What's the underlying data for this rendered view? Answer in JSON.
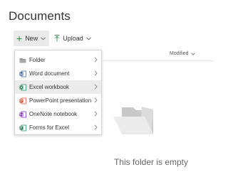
{
  "page": {
    "title": "Documents"
  },
  "commandbar": {
    "new_label": "New",
    "upload_label": "Upload"
  },
  "columns": {
    "modified": "Modified"
  },
  "menu": {
    "items": [
      {
        "label": "Folder",
        "icon": "folder-icon"
      },
      {
        "label": "Word document",
        "icon": "word-icon"
      },
      {
        "label": "Excel workbook",
        "icon": "excel-icon"
      },
      {
        "label": "PowerPoint presentation",
        "icon": "powerpoint-icon"
      },
      {
        "label": "OneNote notebook",
        "icon": "onenote-icon"
      },
      {
        "label": "Forms for Excel",
        "icon": "forms-icon"
      }
    ],
    "hovered_index": 2
  },
  "empty": {
    "message": "This folder is empty"
  },
  "colors": {
    "accent_plus": "#2e8a3e",
    "word": "#2b579a",
    "excel": "#217346",
    "powerpoint": "#d24726",
    "onenote": "#7719aa",
    "forms": "#2d7d5a"
  }
}
